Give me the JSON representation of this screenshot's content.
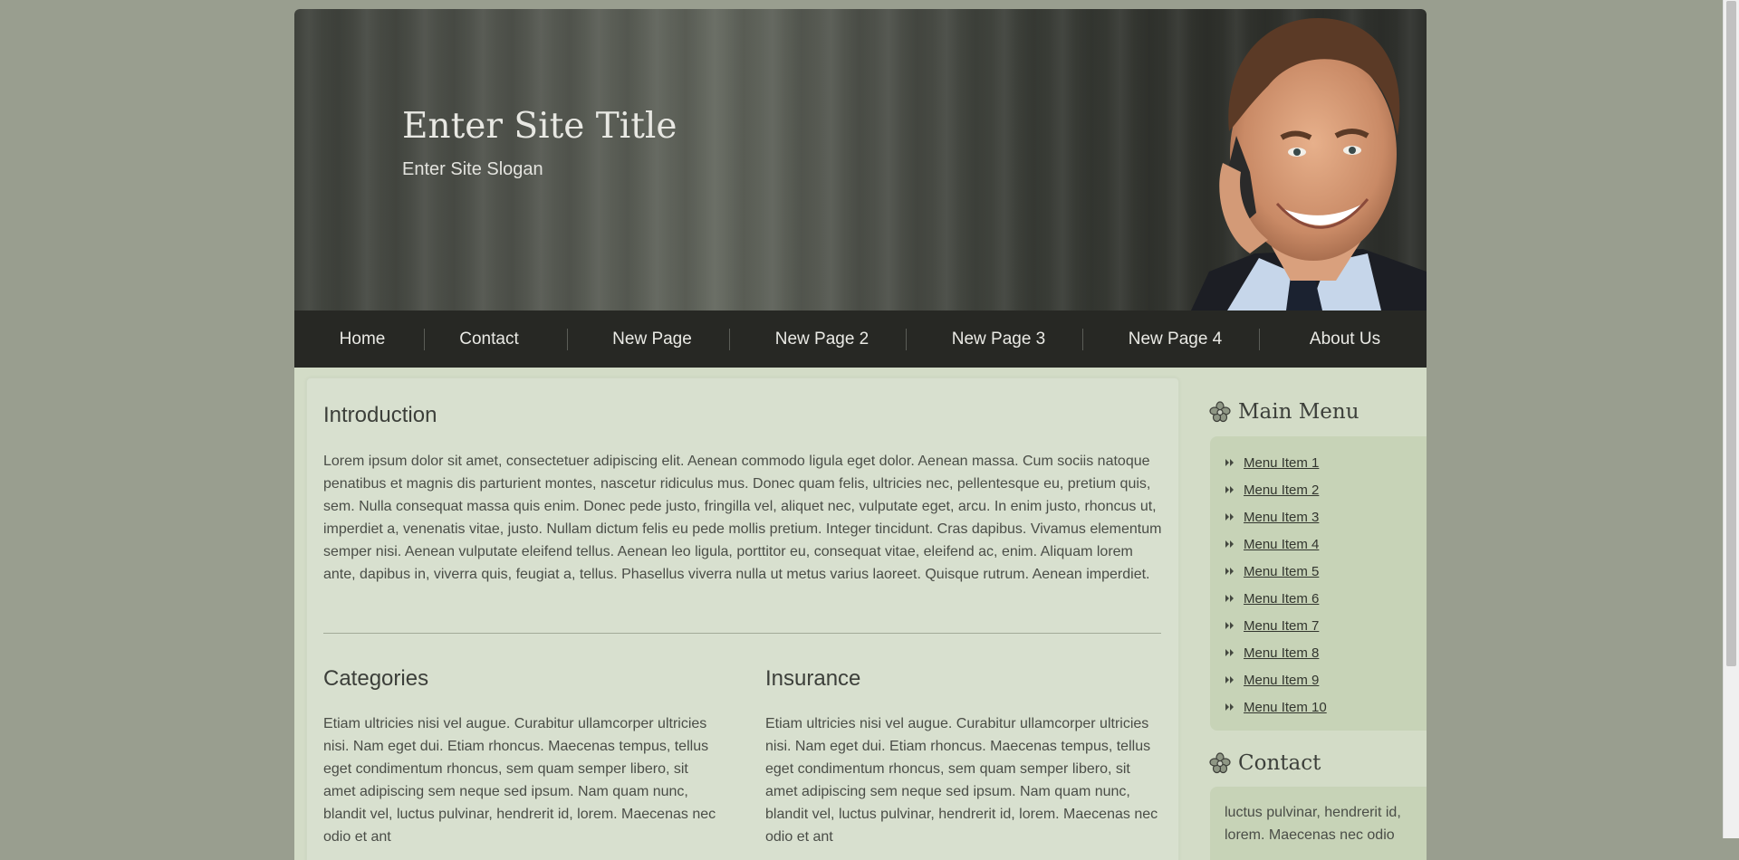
{
  "header": {
    "site_title": "Enter Site Title",
    "site_slogan": "Enter Site Slogan"
  },
  "nav": {
    "items": [
      "Home",
      "Contact",
      "New Page",
      "New Page 2",
      "New Page 3",
      "New Page 4",
      "About Us"
    ]
  },
  "main": {
    "intro_heading": "Introduction",
    "intro_text": "Lorem ipsum dolor sit amet, consectetuer adipiscing elit. Aenean commodo ligula eget dolor. Aenean massa. Cum sociis natoque penatibus et magnis dis parturient montes, nascetur ridiculus mus. Donec quam felis, ultricies nec, pellentesque eu, pretium quis, sem. Nulla consequat massa quis enim. Donec pede justo, fringilla vel, aliquet nec, vulputate eget, arcu. In enim justo, rhoncus ut, imperdiet a, venenatis vitae, justo. Nullam dictum felis eu pede mollis pretium. Integer tincidunt. Cras dapibus. Vivamus elementum semper nisi. Aenean vulputate eleifend tellus. Aenean leo ligula, porttitor eu, consequat vitae, eleifend ac, enim. Aliquam lorem ante, dapibus in, viverra quis, feugiat a, tellus. Phasellus viverra nulla ut metus varius laoreet. Quisque rutrum. Aenean imperdiet.",
    "categories_heading": "Categories",
    "categories_text": "Etiam ultricies nisi vel augue. Curabitur ullamcorper ultricies nisi. Nam eget dui. Etiam rhoncus. Maecenas tempus, tellus eget condimentum rhoncus, sem quam semper libero, sit amet adipiscing sem neque sed ipsum. Nam quam nunc, blandit vel, luctus pulvinar, hendrerit id, lorem. Maecenas nec odio et ant",
    "insurance_heading": "Insurance",
    "insurance_text": "Etiam ultricies nisi vel augue. Curabitur ullamcorper ultricies nisi. Nam eget dui. Etiam rhoncus. Maecenas tempus, tellus eget condimentum rhoncus, sem quam semper libero, sit amet adipiscing sem neque sed ipsum. Nam quam nunc, blandit vel, luctus pulvinar, hendrerit id, lorem. Maecenas nec odio et ant"
  },
  "sidebar": {
    "main_menu_title": "Main Menu",
    "menu_items": [
      "Menu Item 1",
      "Menu Item 2",
      "Menu Item 3",
      "Menu Item 4",
      "Menu Item 5",
      "Menu Item 6",
      "Menu Item 7",
      "Menu Item 8",
      "Menu Item 9",
      "Menu Item 10"
    ],
    "contact_title": "Contact",
    "contact_text": "luctus pulvinar, hendrerit id, lorem. Maecenas nec odio"
  },
  "icons": {
    "heading_icon": "flower-icon",
    "menu_bullet": "double-arrow-icon"
  },
  "colors": {
    "page_bg": "#999e8f",
    "nav_bg": "#272824",
    "content_bg": "#d8e0cf",
    "sidebar_box_bg": "#c7d3b7"
  }
}
